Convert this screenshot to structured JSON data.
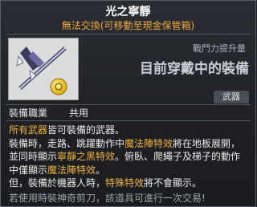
{
  "item": {
    "title": "光之寧靜",
    "trade_note": "無法交換(可移動至現金保管箱)",
    "power_label": "戰鬥力提升量",
    "power_value": "目前穿戴中的裝備",
    "category": "武器",
    "job_label": "裝備職業",
    "job_value": "共用",
    "icon": "staff-weapon-icon"
  },
  "description": {
    "l1_a": "所有武器",
    "l1_b": "皆可裝備的武器。",
    "l2_a": "裝備時，走路、跳躍動作中",
    "l2_b": "魔法陣特效",
    "l2_c": "將在地板展開，",
    "l3_a": "並同時顯示",
    "l3_b": "寧靜之黑特效",
    "l3_c": "。俯臥、爬繩子及梯子的動作",
    "l4_a": "中僅顯示",
    "l4_b": "魔法陣特效",
    "l4_c": "。",
    "l5_a": "但，裝備於機器人時，",
    "l5_b": "特殊特效",
    "l5_c": "將不會顯示。"
  },
  "footer": "若使用時裝神奇剪刀，該道具可進行一次交易!",
  "colors": {
    "highlight": "#f2b43a",
    "trade": "#f2a83b",
    "background": "#1e2024"
  }
}
